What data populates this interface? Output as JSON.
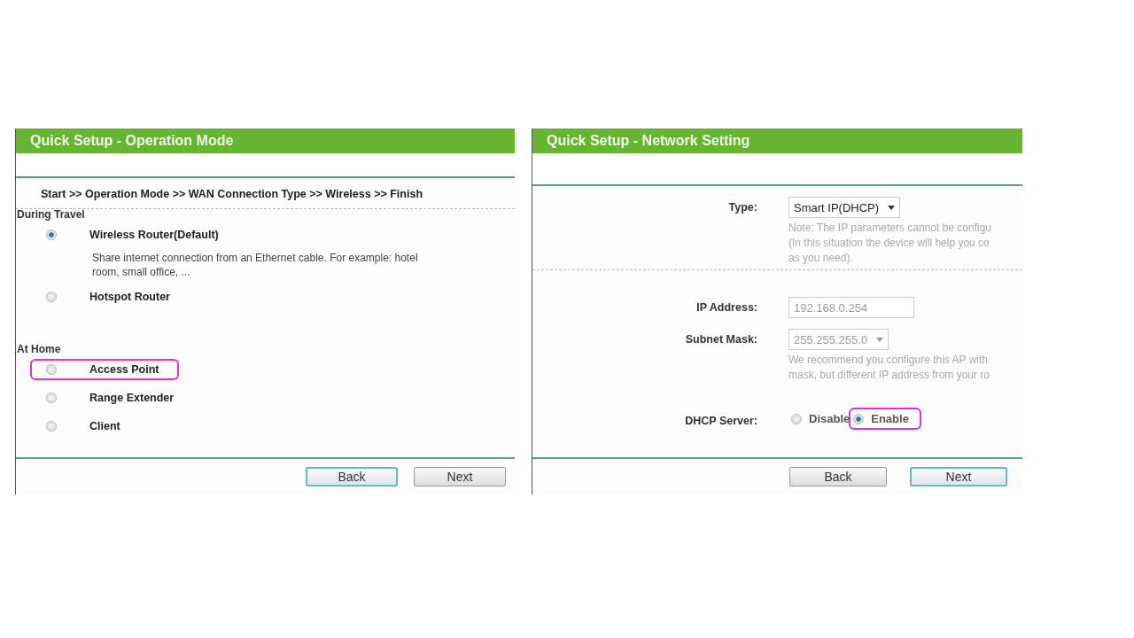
{
  "panels": [
    {
      "kind": "operation_mode",
      "title": "Quick Setup - Operation Mode",
      "breadcrumb": "Start >> Operation Mode >> WAN Connection Type >> Wireless >> Finish",
      "groups": [
        {
          "heading": "During Travel",
          "options": [
            {
              "label": "Wireless Router(Default)",
              "selected": true,
              "highlighted": false,
              "description": [
                "Share internet connection from an Ethernet cable. For example: hotel",
                "room, small office, ..."
              ]
            },
            {
              "label": "Hotspot Router",
              "selected": false,
              "highlighted": false
            }
          ]
        },
        {
          "heading": "At Home",
          "options": [
            {
              "label": "Access Point",
              "selected": false,
              "highlighted": true
            },
            {
              "label": "Range Extender",
              "selected": false,
              "highlighted": false
            },
            {
              "label": "Client",
              "selected": false,
              "highlighted": false
            }
          ]
        }
      ],
      "buttons": [
        {
          "label": "Back",
          "focused": true
        },
        {
          "label": "Next",
          "focused": false
        }
      ]
    },
    {
      "kind": "network_setting",
      "title": "Quick Setup - Network Setting",
      "fields": [
        {
          "kind": "select",
          "label": "Type:",
          "value": "Smart IP(DHCP)",
          "note": [
            "Note: The IP parameters cannot be configu",
            "(In this situation the device will help you co",
            "as you need)."
          ],
          "divider_after": true
        },
        {
          "kind": "text",
          "label": "IP Address:",
          "value": "192.168.0.254",
          "disabled": true
        },
        {
          "kind": "select",
          "label": "Subnet Mask:",
          "value": "255.255.255.0",
          "disabled": true,
          "note": [
            "We recommend you configure this AP with",
            "mask, but different IP address from your ro"
          ]
        },
        {
          "kind": "radio",
          "label": "DHCP Server:",
          "options": [
            {
              "label": "Disable",
              "selected": false,
              "highlighted": false
            },
            {
              "label": "Enable",
              "selected": true,
              "highlighted": true
            }
          ]
        }
      ],
      "buttons": [
        {
          "label": "Back",
          "focused": false
        },
        {
          "label": "Next",
          "focused": true
        }
      ]
    }
  ]
}
